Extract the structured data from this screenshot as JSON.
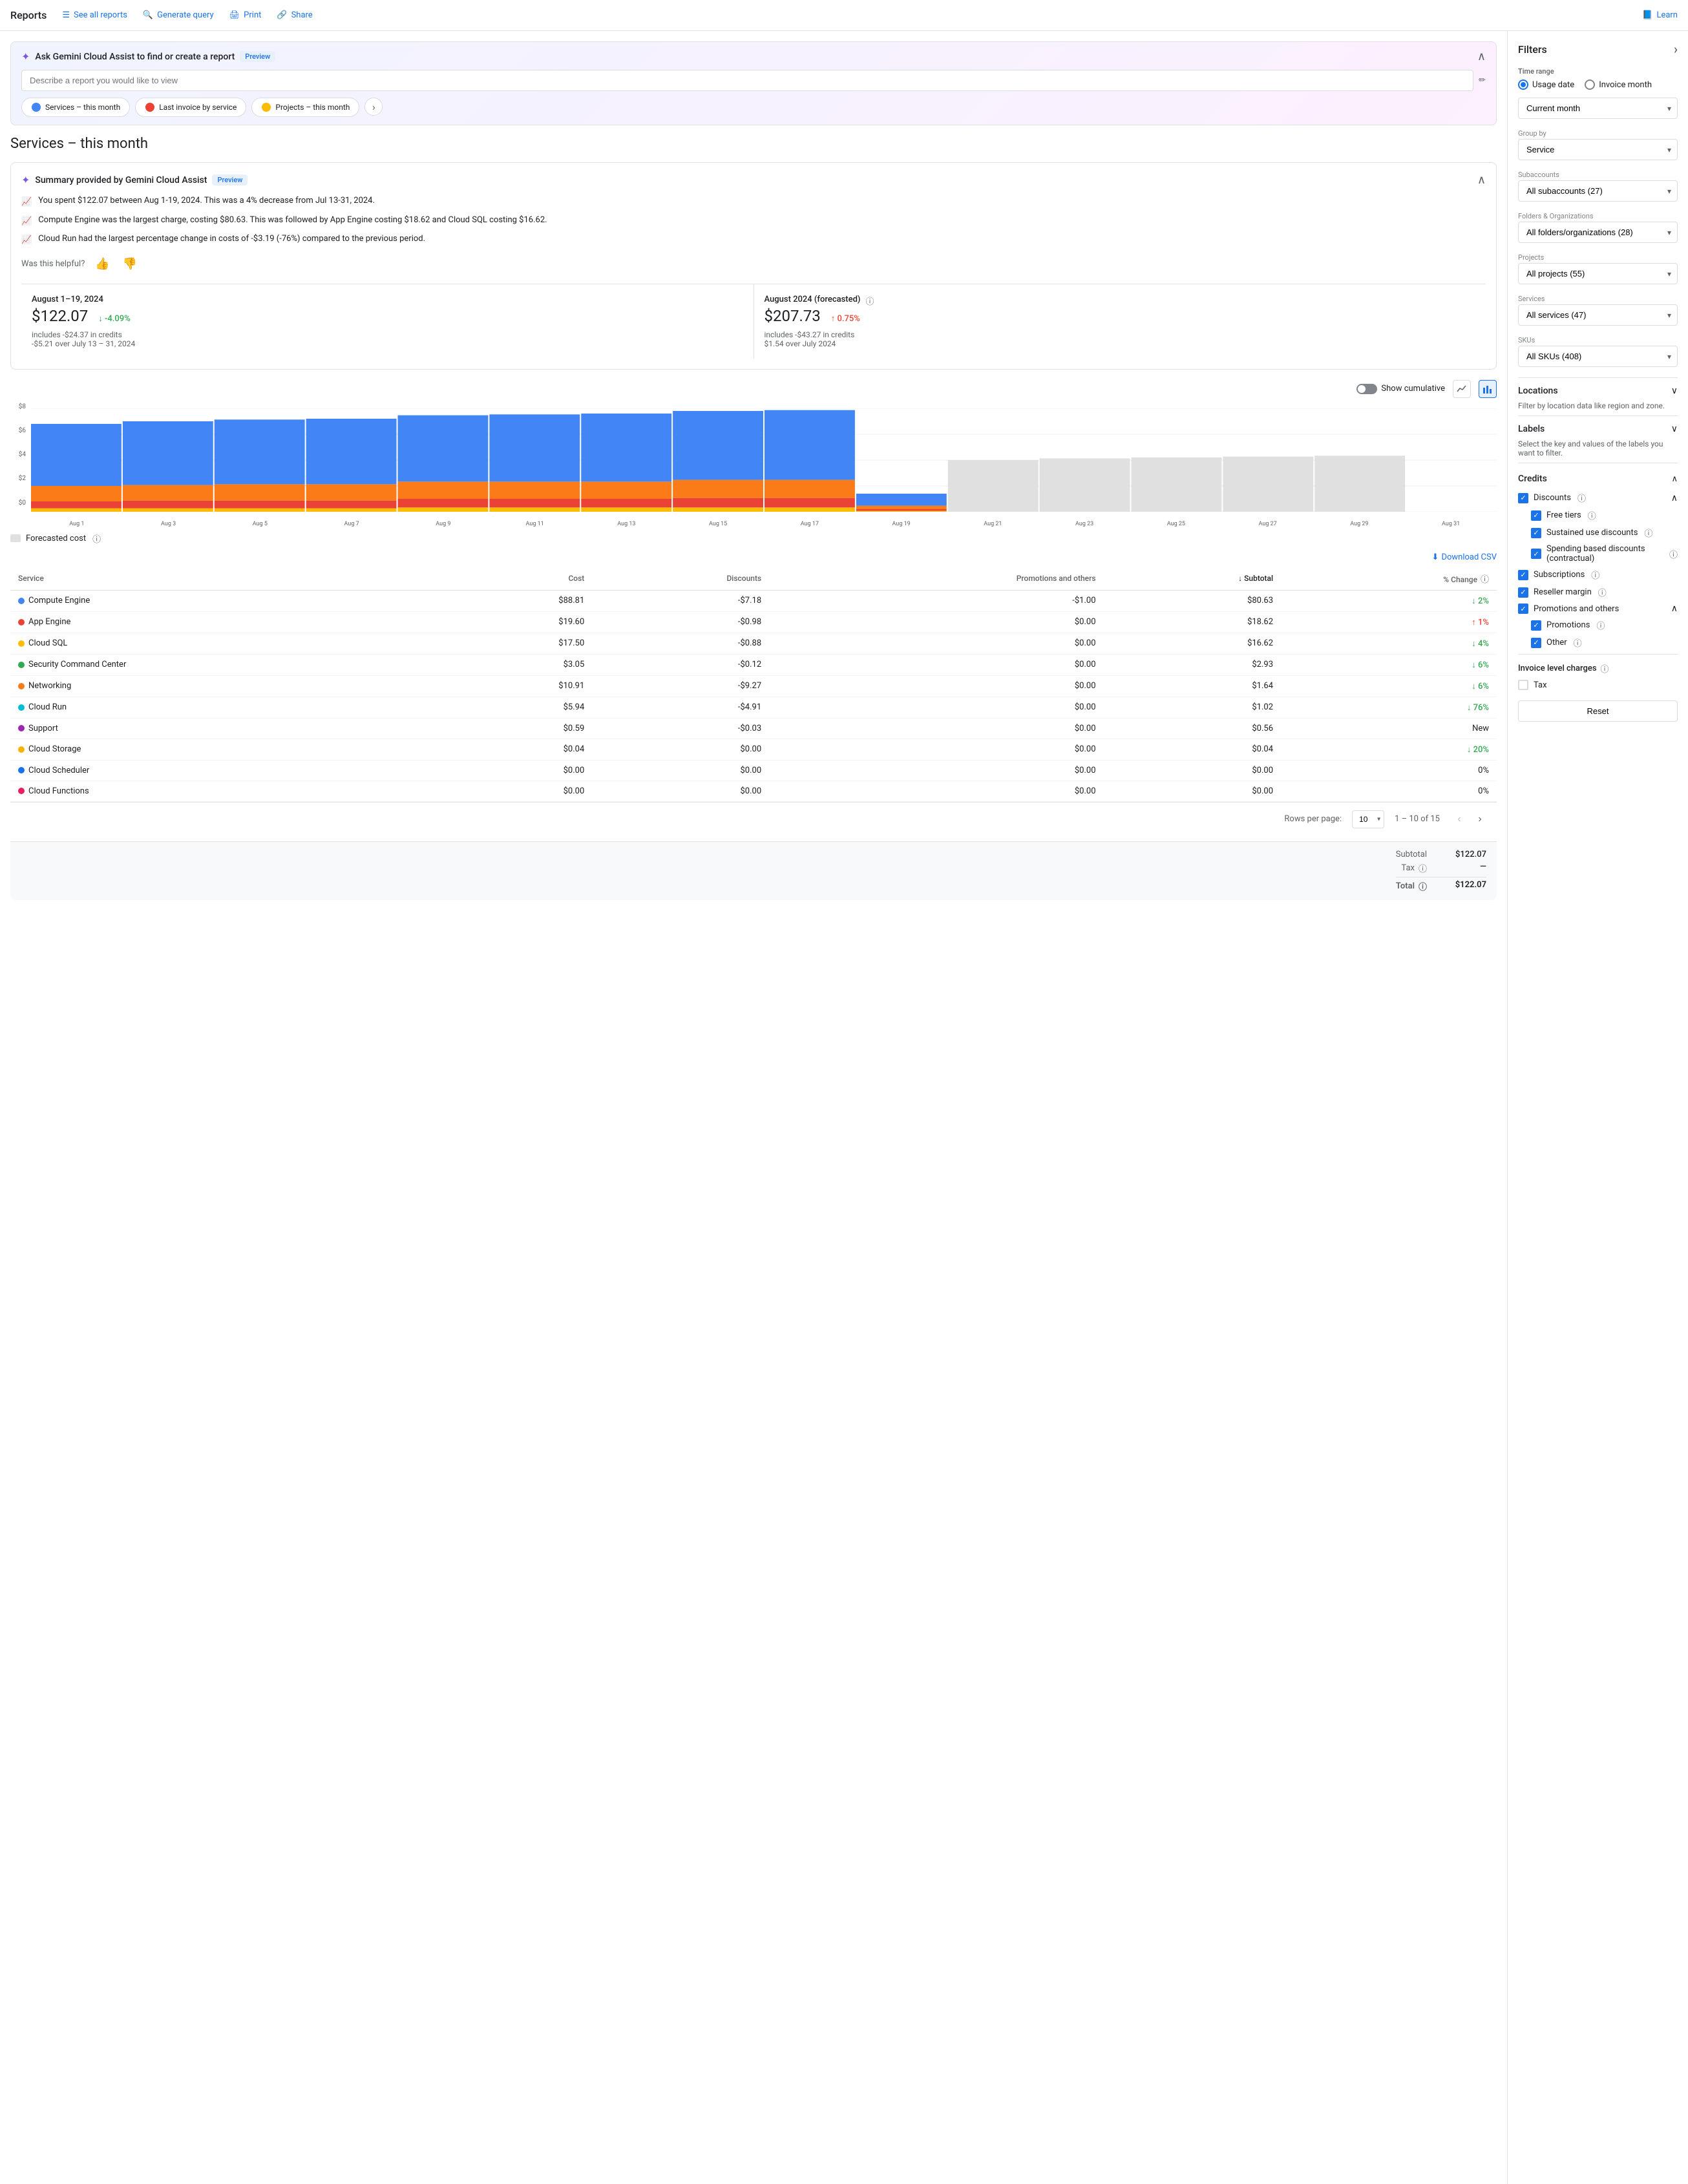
{
  "nav": {
    "title": "Reports",
    "links": [
      {
        "id": "see-all-reports",
        "label": "See all reports",
        "icon": "☰"
      },
      {
        "id": "generate-query",
        "label": "Generate query",
        "icon": "🔍"
      },
      {
        "id": "print",
        "label": "Print",
        "icon": "🖨"
      },
      {
        "id": "share",
        "label": "Share",
        "icon": "🔗"
      },
      {
        "id": "learn",
        "label": "Learn",
        "icon": "📘"
      }
    ]
  },
  "gemini": {
    "title": "Ask Gemini Cloud Assist to find or create a report",
    "preview_badge": "Preview",
    "input_placeholder": "Describe a report you would like to view",
    "chips": [
      {
        "label": "Services – this month",
        "color": "#4285f4"
      },
      {
        "label": "Last invoice by service",
        "color": "#ea4335"
      },
      {
        "label": "Projects – this month",
        "color": "#fbbc04"
      }
    ]
  },
  "page_title": "Services – this month",
  "summary": {
    "title": "Summary provided by Gemini Cloud Assist",
    "preview_badge": "Preview",
    "items": [
      "You spent $122.07 between Aug 1-19, 2024. This was a 4% decrease from Jul 13-31, 2024.",
      "Compute Engine was the largest charge, costing $80.63. This was followed by App Engine costing $18.62 and Cloud SQL costing $16.62.",
      "Cloud Run had the largest percentage change in costs of -$3.19 (-76%) compared to the previous period."
    ],
    "feedback_label": "Was this helpful?"
  },
  "metrics": {
    "current": {
      "period": "August 1–19, 2024",
      "amount": "$122.07",
      "sub": "includes -$24.37 in credits",
      "change": "↓ -4.09%",
      "change_type": "down",
      "change_sub": "-$5.21 over July 13 – 31, 2024"
    },
    "forecasted": {
      "period": "August 2024 (forecasted)",
      "amount": "$207.73",
      "sub": "includes -$43.27 in credits",
      "change": "↑ 0.75%",
      "change_type": "up",
      "change_sub": "$1.54 over July 2024"
    }
  },
  "chart": {
    "show_cumulative_label": "Show cumulative",
    "y_labels": [
      "$8",
      "$6",
      "$4",
      "$2",
      "$0"
    ],
    "forecasted_legend": "Forecasted cost",
    "bars": [
      {
        "label": "Aug 1",
        "blue": 72,
        "orange": 18,
        "red": 8,
        "yellow": 4,
        "forecasted": false
      },
      {
        "label": "Aug 3",
        "blue": 74,
        "orange": 18,
        "red": 9,
        "yellow": 4,
        "forecasted": false
      },
      {
        "label": "Aug 5",
        "blue": 75,
        "orange": 19,
        "red": 9,
        "yellow": 4,
        "forecasted": false
      },
      {
        "label": "Aug 7",
        "blue": 76,
        "orange": 19,
        "red": 9,
        "yellow": 4,
        "forecasted": false
      },
      {
        "label": "Aug 9",
        "blue": 77,
        "orange": 20,
        "red": 10,
        "yellow": 5,
        "forecasted": false
      },
      {
        "label": "Aug 11",
        "blue": 78,
        "orange": 20,
        "red": 10,
        "yellow": 5,
        "forecasted": false
      },
      {
        "label": "Aug 13",
        "blue": 79,
        "orange": 20,
        "red": 10,
        "yellow": 5,
        "forecasted": false
      },
      {
        "label": "Aug 15",
        "blue": 80,
        "orange": 21,
        "red": 11,
        "yellow": 5,
        "forecasted": false
      },
      {
        "label": "Aug 17",
        "blue": 81,
        "orange": 21,
        "red": 11,
        "yellow": 5,
        "forecasted": false
      },
      {
        "label": "Aug 19",
        "blue": 14,
        "orange": 4,
        "red": 2,
        "yellow": 1,
        "forecasted": false
      },
      {
        "label": "Aug 21",
        "blue": 60,
        "orange": 0,
        "red": 0,
        "yellow": 0,
        "forecasted": true
      },
      {
        "label": "Aug 23",
        "blue": 62,
        "orange": 0,
        "red": 0,
        "yellow": 0,
        "forecasted": true
      },
      {
        "label": "Aug 25",
        "blue": 63,
        "orange": 0,
        "red": 0,
        "yellow": 0,
        "forecasted": true
      },
      {
        "label": "Aug 27",
        "blue": 64,
        "orange": 0,
        "red": 0,
        "yellow": 0,
        "forecasted": true
      },
      {
        "label": "Aug 29",
        "blue": 65,
        "orange": 0,
        "red": 0,
        "yellow": 0,
        "forecasted": true
      },
      {
        "label": "Aug 31",
        "blue": 0,
        "orange": 0,
        "red": 0,
        "yellow": 0,
        "forecasted": true
      }
    ]
  },
  "table": {
    "download_csv": "Download CSV",
    "columns": [
      "Service",
      "Cost",
      "Discounts",
      "Promotions and others",
      "Subtotal",
      "% Change"
    ],
    "rows": [
      {
        "service": "Compute Engine",
        "dot": "dot-blue",
        "cost": "$88.81",
        "discounts": "-$7.18",
        "promotions": "-$1.00",
        "subtotal": "$80.63",
        "change": "↓ 2%",
        "change_type": "down"
      },
      {
        "service": "App Engine",
        "dot": "dot-red",
        "cost": "$19.60",
        "discounts": "-$0.98",
        "promotions": "$0.00",
        "subtotal": "$18.62",
        "change": "↑ 1%",
        "change_type": "up"
      },
      {
        "service": "Cloud SQL",
        "dot": "dot-yellow",
        "cost": "$17.50",
        "discounts": "-$0.88",
        "promotions": "$0.00",
        "subtotal": "$16.62",
        "change": "↓ 4%",
        "change_type": "down"
      },
      {
        "service": "Security Command Center",
        "dot": "dot-green-dark",
        "cost": "$3.05",
        "discounts": "-$0.12",
        "promotions": "$0.00",
        "subtotal": "$2.93",
        "change": "↓ 6%",
        "change_type": "down"
      },
      {
        "service": "Networking",
        "dot": "dot-orange",
        "cost": "$10.91",
        "discounts": "-$9.27",
        "promotions": "$0.00",
        "subtotal": "$1.64",
        "change": "↓ 6%",
        "change_type": "down"
      },
      {
        "service": "Cloud Run",
        "dot": "dot-teal",
        "cost": "$5.94",
        "discounts": "-$4.91",
        "promotions": "$0.00",
        "subtotal": "$1.02",
        "change": "↓ 76%",
        "change_type": "down"
      },
      {
        "service": "Support",
        "dot": "dot-purple",
        "cost": "$0.59",
        "discounts": "-$0.03",
        "promotions": "$0.00",
        "subtotal": "$0.56",
        "change": "New",
        "change_type": "neutral"
      },
      {
        "service": "Cloud Storage",
        "dot": "dot-gold",
        "cost": "$0.04",
        "discounts": "$0.00",
        "promotions": "$0.00",
        "subtotal": "$0.04",
        "change": "↓ 20%",
        "change_type": "down"
      },
      {
        "service": "Cloud Scheduler",
        "dot": "dot-navy",
        "cost": "$0.00",
        "discounts": "$0.00",
        "promotions": "$0.00",
        "subtotal": "$0.00",
        "change": "0%",
        "change_type": "neutral"
      },
      {
        "service": "Cloud Functions",
        "dot": "dot-pink",
        "cost": "$0.00",
        "discounts": "$0.00",
        "promotions": "$0.00",
        "subtotal": "$0.00",
        "change": "0%",
        "change_type": "neutral"
      }
    ],
    "pagination": {
      "rows_per_page_label": "Rows per page:",
      "rows_per_page_value": "10",
      "range": "1 – 10 of 15"
    },
    "totals": {
      "subtotal_label": "Subtotal",
      "subtotal_value": "$122.07",
      "tax_label": "Tax",
      "tax_value": "—",
      "total_label": "Total",
      "total_value": "$122.07"
    }
  },
  "filters": {
    "title": "Filters",
    "time_range_label": "Time range",
    "usage_date_label": "Usage date",
    "invoice_month_label": "Invoice month",
    "current_month_label": "Current month",
    "group_by_label": "Group by",
    "group_by_value": "Service",
    "subaccounts_label": "Subaccounts",
    "subaccounts_value": "All subaccounts (27)",
    "folders_label": "Folders & Organizations",
    "folders_value": "All folders/organizations (28)",
    "projects_label": "Projects",
    "projects_value": "All projects (55)",
    "services_label": "Services",
    "services_value": "All services (47)",
    "skus_label": "SKUs",
    "skus_value": "All SKUs (408)",
    "locations_label": "Locations",
    "locations_sub": "Filter by location data like region and zone.",
    "labels_label": "Labels",
    "labels_sub": "Select the key and values of the labels you want to filter.",
    "credits": {
      "label": "Credits",
      "discounts": "Discounts",
      "free_tiers": "Free tiers",
      "sustained_use": "Sustained use discounts",
      "spending_based": "Spending based discounts (contractual)",
      "subscriptions": "Subscriptions",
      "reseller_margin": "Reseller margin",
      "promotions_others": "Promotions and others",
      "promotions": "Promotions",
      "other": "Other"
    },
    "invoice_charges_label": "Invoice level charges",
    "tax_label": "Tax",
    "reset_label": "Reset"
  }
}
